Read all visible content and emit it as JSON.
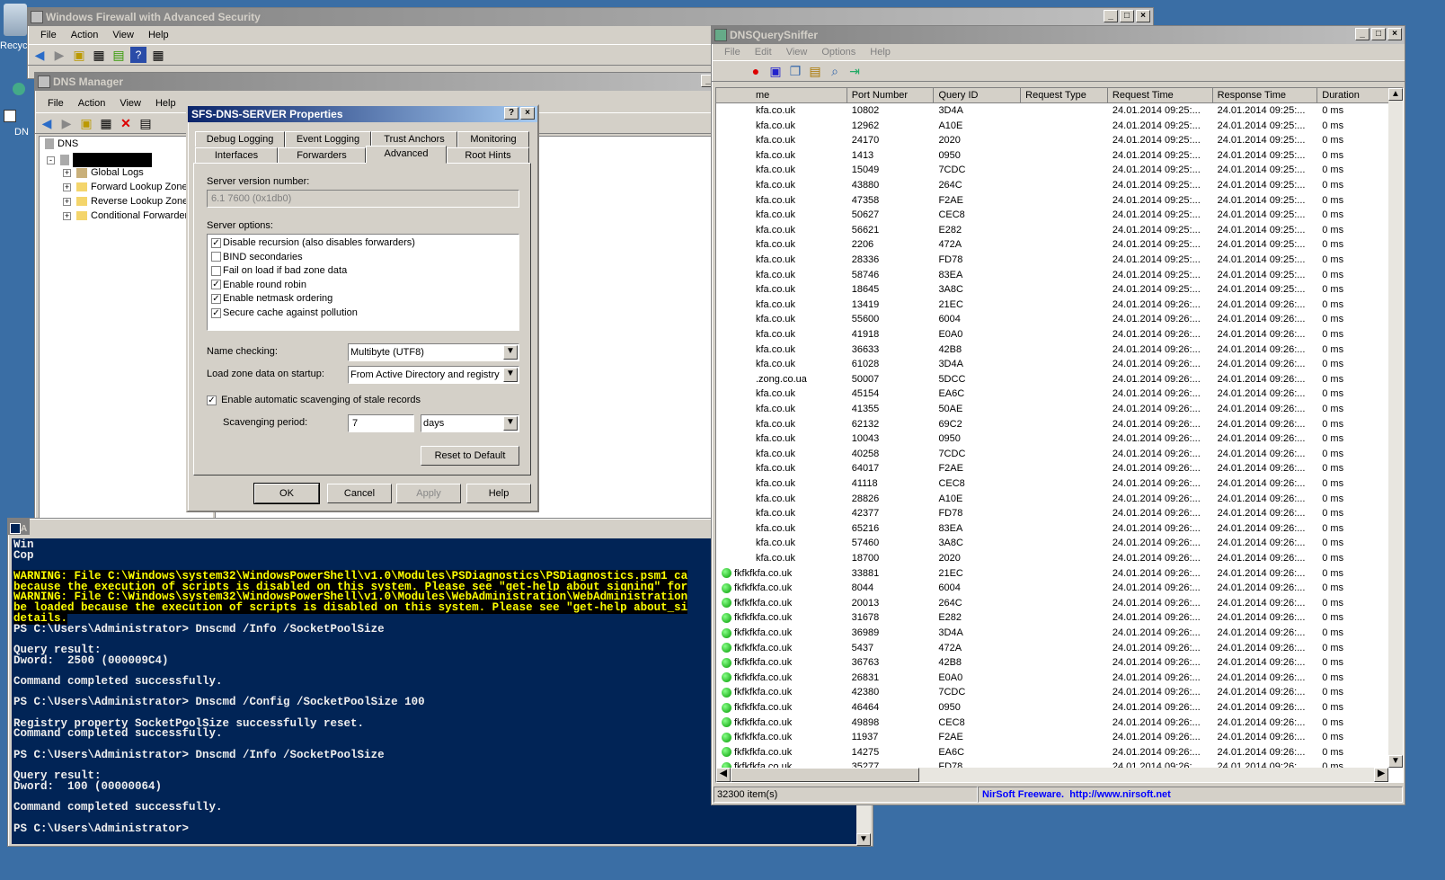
{
  "desktop": {
    "recycle_label": "Recyc",
    "dns_label": "DN"
  },
  "firewall": {
    "title": "Windows Firewall with Advanced Security",
    "menu": [
      "File",
      "Action",
      "View",
      "Help"
    ]
  },
  "dns_manager": {
    "title": "DNS Manager",
    "menu": [
      "File",
      "Action",
      "View",
      "Help"
    ],
    "tree": {
      "root": "DNS",
      "items": [
        "Global Logs",
        "Forward Lookup Zone",
        "Reverse Lookup Zone",
        "Conditional Forwarder"
      ]
    }
  },
  "props": {
    "title": "SFS-DNS-SERVER Properties",
    "tabs_row1": [
      "Debug Logging",
      "Event Logging",
      "Trust Anchors",
      "Monitoring"
    ],
    "tabs_row2": [
      "Interfaces",
      "Forwarders",
      "Advanced",
      "Root Hints"
    ],
    "version_label": "Server version number:",
    "version_value": "6.1 7600 (0x1db0)",
    "options_label": "Server options:",
    "options": [
      {
        "label": "Disable recursion (also disables forwarders)",
        "checked": true
      },
      {
        "label": "BIND secondaries",
        "checked": false
      },
      {
        "label": "Fail on load if bad zone data",
        "checked": false
      },
      {
        "label": "Enable round robin",
        "checked": true
      },
      {
        "label": "Enable netmask ordering",
        "checked": true
      },
      {
        "label": "Secure cache against pollution",
        "checked": true
      }
    ],
    "name_checking_label": "Name checking:",
    "name_checking_value": "Multibyte (UTF8)",
    "load_zone_label": "Load zone data on startup:",
    "load_zone_value": "From Active Directory and registry",
    "scavenging_label": "Enable automatic scavenging of stale records",
    "scavenging_period_label": "Scavenging period:",
    "scavenging_value": "7",
    "scavenging_unit": "days",
    "reset_button": "Reset to Default",
    "ok": "OK",
    "cancel": "Cancel",
    "apply": "Apply",
    "help": "Help"
  },
  "sniffer": {
    "title": "DNSQuerySniffer",
    "menu": [
      "File",
      "Edit",
      "View",
      "Options",
      "Help"
    ],
    "columns": [
      "me",
      "Port Number",
      "Query ID",
      "Request Type",
      "Request Time",
      "Response Time",
      "Duration"
    ],
    "rows": [
      [
        "kfa.co.uk",
        "10802",
        "3D4A",
        "",
        "24.01.2014 09:25:...",
        "24.01.2014 09:25:...",
        "0 ms",
        false
      ],
      [
        "kfa.co.uk",
        "12962",
        "A10E",
        "",
        "24.01.2014 09:25:...",
        "24.01.2014 09:25:...",
        "0 ms",
        false
      ],
      [
        "kfa.co.uk",
        "24170",
        "2020",
        "",
        "24.01.2014 09:25:...",
        "24.01.2014 09:25:...",
        "0 ms",
        false
      ],
      [
        "kfa.co.uk",
        "1413",
        "0950",
        "",
        "24.01.2014 09:25:...",
        "24.01.2014 09:25:...",
        "0 ms",
        false
      ],
      [
        "kfa.co.uk",
        "15049",
        "7CDC",
        "",
        "24.01.2014 09:25:...",
        "24.01.2014 09:25:...",
        "0 ms",
        false
      ],
      [
        "kfa.co.uk",
        "43880",
        "264C",
        "",
        "24.01.2014 09:25:...",
        "24.01.2014 09:25:...",
        "0 ms",
        false
      ],
      [
        "kfa.co.uk",
        "47358",
        "F2AE",
        "",
        "24.01.2014 09:25:...",
        "24.01.2014 09:25:...",
        "0 ms",
        false
      ],
      [
        "kfa.co.uk",
        "50627",
        "CEC8",
        "",
        "24.01.2014 09:25:...",
        "24.01.2014 09:25:...",
        "0 ms",
        false
      ],
      [
        "kfa.co.uk",
        "56621",
        "E282",
        "",
        "24.01.2014 09:25:...",
        "24.01.2014 09:25:...",
        "0 ms",
        false
      ],
      [
        "kfa.co.uk",
        "2206",
        "472A",
        "",
        "24.01.2014 09:25:...",
        "24.01.2014 09:25:...",
        "0 ms",
        false
      ],
      [
        "kfa.co.uk",
        "28336",
        "FD78",
        "",
        "24.01.2014 09:25:...",
        "24.01.2014 09:25:...",
        "0 ms",
        false
      ],
      [
        "kfa.co.uk",
        "58746",
        "83EA",
        "",
        "24.01.2014 09:25:...",
        "24.01.2014 09:25:...",
        "0 ms",
        false
      ],
      [
        "kfa.co.uk",
        "18645",
        "3A8C",
        "",
        "24.01.2014 09:25:...",
        "24.01.2014 09:25:...",
        "0 ms",
        false
      ],
      [
        "kfa.co.uk",
        "13419",
        "21EC",
        "",
        "24.01.2014 09:26:...",
        "24.01.2014 09:26:...",
        "0 ms",
        false
      ],
      [
        "kfa.co.uk",
        "55600",
        "6004",
        "",
        "24.01.2014 09:26:...",
        "24.01.2014 09:26:...",
        "0 ms",
        false
      ],
      [
        "kfa.co.uk",
        "41918",
        "E0A0",
        "",
        "24.01.2014 09:26:...",
        "24.01.2014 09:26:...",
        "0 ms",
        false
      ],
      [
        "kfa.co.uk",
        "36633",
        "42B8",
        "",
        "24.01.2014 09:26:...",
        "24.01.2014 09:26:...",
        "0 ms",
        false
      ],
      [
        "kfa.co.uk",
        "61028",
        "3D4A",
        "",
        "24.01.2014 09:26:...",
        "24.01.2014 09:26:...",
        "0 ms",
        false
      ],
      [
        ".zong.co.ua",
        "50007",
        "5DCC",
        "",
        "24.01.2014 09:26:...",
        "24.01.2014 09:26:...",
        "0 ms",
        false
      ],
      [
        "kfa.co.uk",
        "45154",
        "EA6C",
        "",
        "24.01.2014 09:26:...",
        "24.01.2014 09:26:...",
        "0 ms",
        false
      ],
      [
        "kfa.co.uk",
        "41355",
        "50AE",
        "",
        "24.01.2014 09:26:...",
        "24.01.2014 09:26:...",
        "0 ms",
        false
      ],
      [
        "kfa.co.uk",
        "62132",
        "69C2",
        "",
        "24.01.2014 09:26:...",
        "24.01.2014 09:26:...",
        "0 ms",
        false
      ],
      [
        "kfa.co.uk",
        "10043",
        "0950",
        "",
        "24.01.2014 09:26:...",
        "24.01.2014 09:26:...",
        "0 ms",
        false
      ],
      [
        "kfa.co.uk",
        "40258",
        "7CDC",
        "",
        "24.01.2014 09:26:...",
        "24.01.2014 09:26:...",
        "0 ms",
        false
      ],
      [
        "kfa.co.uk",
        "64017",
        "F2AE",
        "",
        "24.01.2014 09:26:...",
        "24.01.2014 09:26:...",
        "0 ms",
        false
      ],
      [
        "kfa.co.uk",
        "41118",
        "CEC8",
        "",
        "24.01.2014 09:26:...",
        "24.01.2014 09:26:...",
        "0 ms",
        false
      ],
      [
        "kfa.co.uk",
        "28826",
        "A10E",
        "",
        "24.01.2014 09:26:...",
        "24.01.2014 09:26:...",
        "0 ms",
        false
      ],
      [
        "kfa.co.uk",
        "42377",
        "FD78",
        "",
        "24.01.2014 09:26:...",
        "24.01.2014 09:26:...",
        "0 ms",
        false
      ],
      [
        "kfa.co.uk",
        "65216",
        "83EA",
        "",
        "24.01.2014 09:26:...",
        "24.01.2014 09:26:...",
        "0 ms",
        false
      ],
      [
        "kfa.co.uk",
        "57460",
        "3A8C",
        "",
        "24.01.2014 09:26:...",
        "24.01.2014 09:26:...",
        "0 ms",
        false
      ],
      [
        "kfa.co.uk",
        "18700",
        "2020",
        "",
        "24.01.2014 09:26:...",
        "24.01.2014 09:26:...",
        "0 ms",
        false
      ],
      [
        "fkfkfkfa.co.uk",
        "33881",
        "21EC",
        "",
        "24.01.2014 09:26:...",
        "24.01.2014 09:26:...",
        "0 ms",
        true
      ],
      [
        "fkfkfkfa.co.uk",
        "8044",
        "6004",
        "",
        "24.01.2014 09:26:...",
        "24.01.2014 09:26:...",
        "0 ms",
        true
      ],
      [
        "fkfkfkfa.co.uk",
        "20013",
        "264C",
        "",
        "24.01.2014 09:26:...",
        "24.01.2014 09:26:...",
        "0 ms",
        true
      ],
      [
        "fkfkfkfa.co.uk",
        "31678",
        "E282",
        "",
        "24.01.2014 09:26:...",
        "24.01.2014 09:26:...",
        "0 ms",
        true
      ],
      [
        "fkfkfkfa.co.uk",
        "36989",
        "3D4A",
        "",
        "24.01.2014 09:26:...",
        "24.01.2014 09:26:...",
        "0 ms",
        true
      ],
      [
        "fkfkfkfa.co.uk",
        "5437",
        "472A",
        "",
        "24.01.2014 09:26:...",
        "24.01.2014 09:26:...",
        "0 ms",
        true
      ],
      [
        "fkfkfkfa.co.uk",
        "36763",
        "42B8",
        "",
        "24.01.2014 09:26:...",
        "24.01.2014 09:26:...",
        "0 ms",
        true
      ],
      [
        "fkfkfkfa.co.uk",
        "26831",
        "E0A0",
        "",
        "24.01.2014 09:26:...",
        "24.01.2014 09:26:...",
        "0 ms",
        true
      ],
      [
        "fkfkfkfa.co.uk",
        "42380",
        "7CDC",
        "",
        "24.01.2014 09:26:...",
        "24.01.2014 09:26:...",
        "0 ms",
        true
      ],
      [
        "fkfkfkfa.co.uk",
        "46464",
        "0950",
        "",
        "24.01.2014 09:26:...",
        "24.01.2014 09:26:...",
        "0 ms",
        true
      ],
      [
        "fkfkfkfa.co.uk",
        "49898",
        "CEC8",
        "",
        "24.01.2014 09:26:...",
        "24.01.2014 09:26:...",
        "0 ms",
        true
      ],
      [
        "fkfkfkfa.co.uk",
        "11937",
        "F2AE",
        "",
        "24.01.2014 09:26:...",
        "24.01.2014 09:26:...",
        "0 ms",
        true
      ],
      [
        "fkfkfkfa.co.uk",
        "14275",
        "EA6C",
        "",
        "24.01.2014 09:26:...",
        "24.01.2014 09:26:...",
        "0 ms",
        true
      ],
      [
        "fkfkfkfa.co.uk",
        "35277",
        "FD78",
        "",
        "24.01.2014 09:26:...",
        "24.01.2014 09:26:...",
        "0 ms",
        true
      ]
    ],
    "status_count": "32300 item(s)",
    "status_brand": "NirSoft Freeware.  http://www.nirsoft.net"
  },
  "powershell": {
    "title_letter": "A",
    "lines": [
      {
        "t": "Win",
        "w": false
      },
      {
        "t": "Cop",
        "w": false
      },
      {
        "t": "",
        "w": false
      },
      {
        "t": "WARNING: File C:\\Windows\\system32\\WindowsPowerShell\\v1.0\\Modules\\PSDiagnostics\\PSDiagnostics.psm1 ca",
        "w": true
      },
      {
        "t": "because the execution of scripts is disabled on this system. Please see \"get-help about_signing\" for",
        "w": true
      },
      {
        "t": "WARNING: File C:\\Windows\\system32\\WindowsPowerShell\\v1.0\\Modules\\WebAdministration\\WebAdministration",
        "w": true
      },
      {
        "t": "be loaded because the execution of scripts is disabled on this system. Please see \"get-help about_si",
        "w": true
      },
      {
        "t": "details.",
        "w": true
      },
      {
        "t": "PS C:\\Users\\Administrator> Dnscmd /Info /SocketPoolSize",
        "w": false
      },
      {
        "t": "",
        "w": false
      },
      {
        "t": "Query result:",
        "w": false
      },
      {
        "t": "Dword:  2500 (000009C4)",
        "w": false
      },
      {
        "t": "",
        "w": false
      },
      {
        "t": "Command completed successfully.",
        "w": false
      },
      {
        "t": "",
        "w": false
      },
      {
        "t": "PS C:\\Users\\Administrator> Dnscmd /Config /SocketPoolSize 100",
        "w": false
      },
      {
        "t": "",
        "w": false
      },
      {
        "t": "Registry property SocketPoolSize successfully reset.",
        "w": false
      },
      {
        "t": "Command completed successfully.",
        "w": false
      },
      {
        "t": "",
        "w": false
      },
      {
        "t": "PS C:\\Users\\Administrator> Dnscmd /Info /SocketPoolSize",
        "w": false
      },
      {
        "t": "",
        "w": false
      },
      {
        "t": "Query result:",
        "w": false
      },
      {
        "t": "Dword:  100 (00000064)",
        "w": false
      },
      {
        "t": "",
        "w": false
      },
      {
        "t": "Command completed successfully.",
        "w": false
      },
      {
        "t": "",
        "w": false
      },
      {
        "t": "PS C:\\Users\\Administrator>",
        "w": false
      }
    ]
  }
}
